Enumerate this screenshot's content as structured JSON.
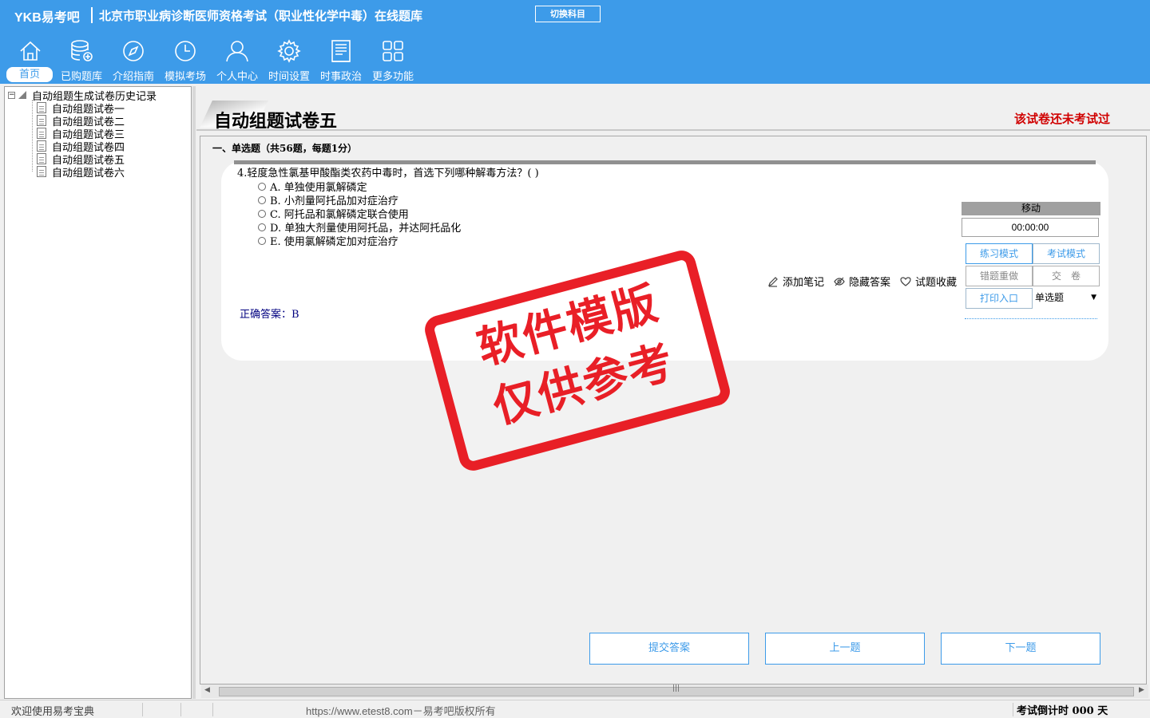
{
  "header": {
    "brand": "YKB易考吧",
    "title": "北京市职业病诊断医师资格考试（职业性化学中毒）在线题库",
    "switch_label": "切换科目",
    "accent": "#3d9be9"
  },
  "nav": [
    {
      "label": "首页",
      "icon": "home-icon",
      "active": true
    },
    {
      "label": "已购题库",
      "icon": "database-icon"
    },
    {
      "label": "介绍指南",
      "icon": "compass-icon"
    },
    {
      "label": "模拟考场",
      "icon": "clock-icon"
    },
    {
      "label": "个人中心",
      "icon": "user-icon"
    },
    {
      "label": "时间设置",
      "icon": "gear-icon"
    },
    {
      "label": "时事政治",
      "icon": "newspaper-icon"
    },
    {
      "label": "更多功能",
      "icon": "grid-icon"
    }
  ],
  "tree": {
    "root": "自动组题生成试卷历史记录",
    "items": [
      "自动组题试卷一",
      "自动组题试卷二",
      "自动组题试卷三",
      "自动组题试卷四",
      "自动组题试卷五",
      "自动组题试卷六"
    ]
  },
  "paper": {
    "title": "自动组题试卷五",
    "status": "该试卷还未考试过",
    "section": "一、单选题（共56题，每题1分）"
  },
  "question": {
    "text": "4.轻度急性氯基甲酸酯类农药中毒时，首选下列哪种解毒方法？( )",
    "options": [
      "A. 单独使用氯解磷定",
      "B. 小剂量阿托品加对症治疗",
      "C. 阿托品和氯解磷定联合使用",
      "D. 单独大剂量使用阿托品，并达阿托品化",
      "E. 使用氯解磷定加对症治疗"
    ],
    "answer": "正确答案：B"
  },
  "tools": {
    "add_note": "添加笔记",
    "hide_answer": "隐藏答案",
    "favorite": "试题收藏"
  },
  "panel": {
    "move": "移动",
    "timer": "00:00:00",
    "practice_mode": "练习模式",
    "exam_mode": "考试模式",
    "redo_wrong": "错题重做",
    "submit_paper": "交　卷",
    "print": "打印入口",
    "question_type": "单选题"
  },
  "bottom": {
    "submit": "提交答案",
    "prev": "上一题",
    "next": "下一题"
  },
  "status": {
    "welcome": "欢迎使用易考宝典",
    "copyright": "https://www.etest8.com－易考吧版权所有",
    "countdown": "考试倒计时 000 天"
  },
  "watermark": {
    "line1": "软件模版",
    "line2": "仅供参考",
    "color": "#e8141c"
  }
}
